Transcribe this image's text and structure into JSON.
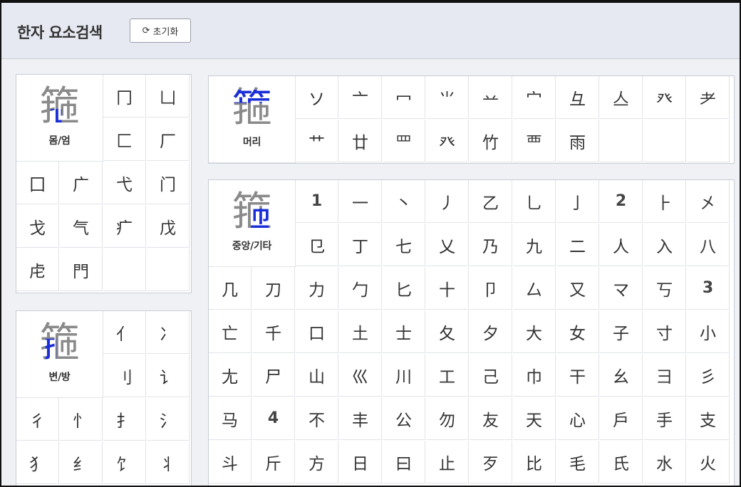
{
  "header": {
    "title": "한자 요소검색",
    "reset_label": "초기화",
    "reset_icon": "refresh-icon"
  },
  "glyph": "箍",
  "colors": {
    "highlight": "#1a2fd8",
    "base": "#8a8a8a"
  },
  "enclosure": {
    "label": "몸/엄",
    "radicals": [
      "冂",
      "凵",
      "匚",
      "厂",
      "囗",
      "广",
      "弋",
      "门",
      "戈",
      "气",
      "疒",
      "戊",
      "虍",
      "門"
    ]
  },
  "side": {
    "label": "변/방",
    "radicals": [
      "亻",
      "冫",
      "刂",
      "讠",
      "彳",
      "忄",
      "扌",
      "氵",
      "犭",
      "纟",
      "饣",
      "丬"
    ]
  },
  "top": {
    "label": "머리",
    "radicals": [
      "ソ",
      "亠",
      "冖",
      "⺌",
      "䒑",
      "宀",
      "彑",
      "亼",
      "癶",
      "耂",
      "艹",
      "廿",
      "罒",
      "癶",
      "竹",
      "覀",
      "雨"
    ]
  },
  "center": {
    "label": "중앙/기타",
    "items": [
      "1",
      "一",
      "丶",
      "丿",
      "乙",
      "乚",
      "亅",
      "2",
      "⺊",
      "㐅",
      "㔾",
      "丁",
      "七",
      "乂",
      "乃",
      "九",
      "二",
      "人",
      "入",
      "八",
      "几",
      "刀",
      "力",
      "勹",
      "匕",
      "十",
      "卩",
      "厶",
      "又",
      "マ",
      "丂",
      "3",
      "亡",
      "千",
      "口",
      "土",
      "士",
      "夂",
      "夕",
      "大",
      "女",
      "子",
      "寸",
      "小",
      "尢",
      "尸",
      "山",
      "巛",
      "川",
      "工",
      "己",
      "巾",
      "干",
      "幺",
      "彐",
      "彡",
      "马",
      "4",
      "不",
      "丰",
      "公",
      "勿",
      "友",
      "天",
      "心",
      "戶",
      "手",
      "支",
      "斗",
      "斤",
      "方",
      "日",
      "曰",
      "止",
      "歹",
      "比",
      "毛",
      "氏",
      "水",
      "火"
    ]
  }
}
